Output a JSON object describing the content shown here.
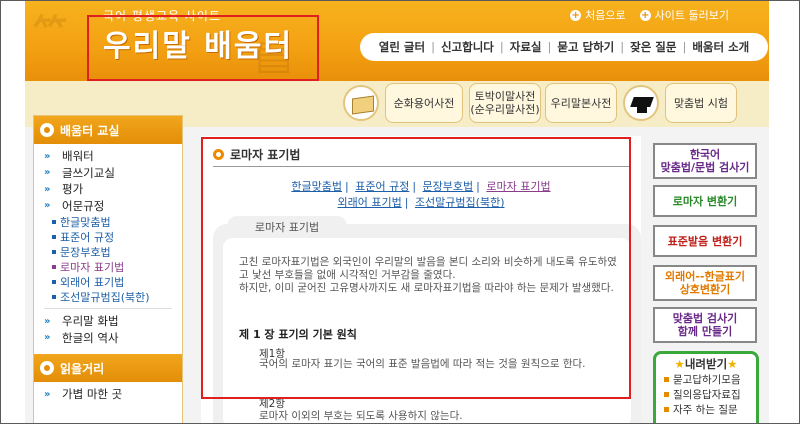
{
  "header": {
    "subtitle": "국어 평생교육 사이트·",
    "title": "우리말 배움터",
    "top_links": [
      {
        "label": "처음으로"
      },
      {
        "label": "사이트 둘러보기"
      }
    ],
    "nav": [
      "열린 글터",
      "신고합니다",
      "자료실",
      "묻고 답하기",
      "잦은 질문",
      "배움터 소개"
    ]
  },
  "dict_bar": {
    "items": [
      {
        "label": "순화용어사전"
      },
      {
        "label": "토박이말사전",
        "sub": "(순우리말사전)"
      },
      {
        "label": "우리말본사전"
      },
      {
        "label": "맞춤법 시험"
      }
    ]
  },
  "sidebar": {
    "section1_title": "배움터 교실",
    "items": [
      {
        "label": "배워터"
      },
      {
        "label": "글쓰기교실"
      },
      {
        "label": "평가"
      },
      {
        "label": "어문규정"
      }
    ],
    "sub_items": [
      {
        "label": "한글맞춤법"
      },
      {
        "label": "표준어 규정"
      },
      {
        "label": "문장부호법"
      },
      {
        "label": "로마자 표기법"
      },
      {
        "label": "외래어 표기법"
      },
      {
        "label": "조선말규범집(북한)"
      }
    ],
    "items2": [
      {
        "label": "우리말 화법"
      },
      {
        "label": "한글의 역사"
      }
    ],
    "section2_title": "읽을거리",
    "section2_first": "가볍 마한 곳"
  },
  "content": {
    "title": "로마자 표기법",
    "links_row1": [
      "한글맞춤법",
      "표준어 규정",
      "문장부호법",
      "로마자 표기법"
    ],
    "links_row2": [
      "외래어 표기법",
      "조선말규범집(북한)"
    ],
    "panel_tab": "로마자 표기법",
    "intro": "고친 로마자표기법은 외국인이 우리말의 발음을 본디 소리와 비슷하게 내도록 유도하였고 낯선 부호들을 없애 시각적인 거부감을 줄였다.\n하지만, 이미 굳어진 고유명사까지도 새 로마자표기법을 따라야 하는 문제가 발생했다.",
    "chapter": "제 1 장 표기의 기본 원칙",
    "article1_title": "제1항",
    "article1_text": "국어의 로마자 표기는 국어의 표준 발음법에 따라 적는 것을 원칙으로 한다.",
    "article2_title": "제2항",
    "article2_text": "로마자 이외의 부호는 되도록 사용하지 않는다."
  },
  "right": {
    "buttons": [
      {
        "line1": "한국어",
        "line2": "맞춤법/문법 검사기",
        "color": "#6a2a8a"
      },
      {
        "line1": "로마자 변환기",
        "line2": "",
        "color": "#2a8a2a"
      },
      {
        "line1": "표준발음 변환기",
        "line2": "",
        "color": "#c0201a"
      },
      {
        "line1": "외래어--한글표기",
        "line2": "상호변환기",
        "color": "#e07a00"
      },
      {
        "line1": "맞춤법 검사기",
        "line2": "함께 만들기",
        "color": "#6a2a8a"
      }
    ],
    "download_title": "내려받기",
    "downloads": [
      "묻고답하기모음",
      "질의응답자료집",
      "자주 하는 질문"
    ]
  }
}
